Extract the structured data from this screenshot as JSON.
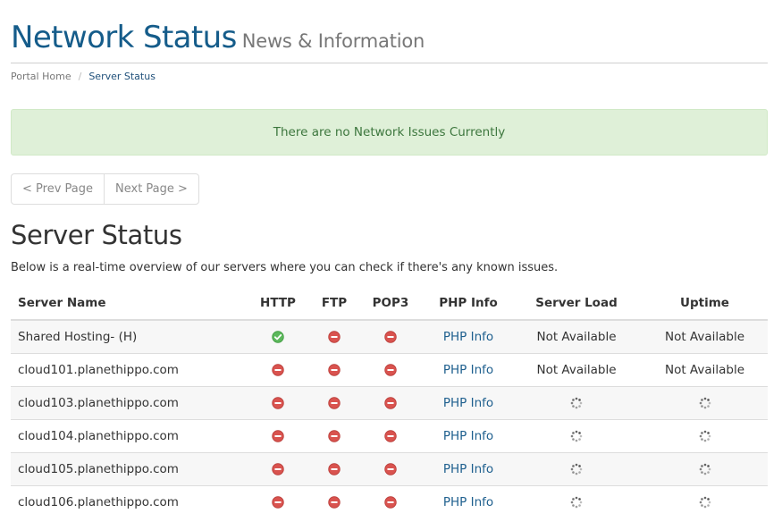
{
  "header": {
    "title": "Network Status",
    "subtitle": "News & Information"
  },
  "breadcrumb": [
    {
      "label": "Portal Home"
    },
    {
      "label": "Server Status"
    }
  ],
  "alert": {
    "text": "There are no Network Issues Currently"
  },
  "pagination": {
    "prev_label": "< Prev Page",
    "next_label": "Next Page >"
  },
  "server_status": {
    "title": "Server Status",
    "description": "Below is a real-time overview of our servers where you can check if there's any known issues.",
    "columns": [
      "Server Name",
      "HTTP",
      "FTP",
      "POP3",
      "PHP Info",
      "Server Load",
      "Uptime"
    ],
    "rows": [
      {
        "name": "Shared Hosting- (H)",
        "http": "up",
        "ftp": "down",
        "pop3": "down",
        "php_info": "PHP Info",
        "server_load": "Not Available",
        "uptime": "Not Available"
      },
      {
        "name": "cloud101.planethippo.com",
        "http": "down",
        "ftp": "down",
        "pop3": "down",
        "php_info": "PHP Info",
        "server_load": "Not Available",
        "uptime": "Not Available"
      },
      {
        "name": "cloud103.planethippo.com",
        "http": "down",
        "ftp": "down",
        "pop3": "down",
        "php_info": "PHP Info",
        "server_load": "loading",
        "uptime": "loading"
      },
      {
        "name": "cloud104.planethippo.com",
        "http": "down",
        "ftp": "down",
        "pop3": "down",
        "php_info": "PHP Info",
        "server_load": "loading",
        "uptime": "loading"
      },
      {
        "name": "cloud105.planethippo.com",
        "http": "down",
        "ftp": "down",
        "pop3": "down",
        "php_info": "PHP Info",
        "server_load": "loading",
        "uptime": "loading"
      },
      {
        "name": "cloud106.planethippo.com",
        "http": "down",
        "ftp": "down",
        "pop3": "down",
        "php_info": "PHP Info",
        "server_load": "loading",
        "uptime": "loading"
      }
    ]
  },
  "icons": {
    "up": "check-circle-icon",
    "down": "minus-circle-icon",
    "loading": "spinner-icon"
  },
  "colors": {
    "brand": "#155c8a",
    "link": "#1e5f8e",
    "success_bg": "#dff0d8",
    "success_text": "#3c763d",
    "up": "#5cb85c",
    "down": "#d9534f"
  }
}
